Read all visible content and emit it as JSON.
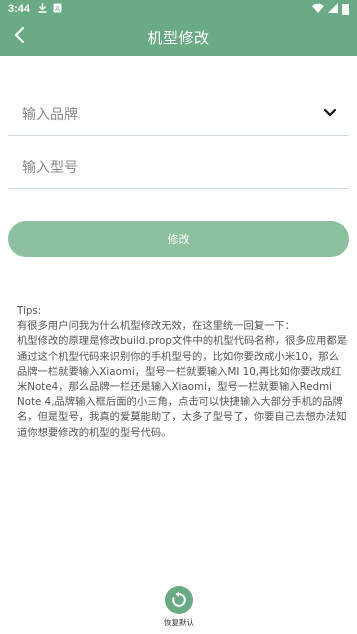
{
  "status_bar": {
    "time": "3:44",
    "icons": [
      "download-icon",
      "notification-a-icon"
    ],
    "right_icons": [
      "wifi-icon",
      "signal-icon",
      "battery-icon"
    ]
  },
  "app_bar": {
    "title": "机型修改",
    "back_icon": "chevron-left-icon"
  },
  "form": {
    "brand_placeholder": "输入品牌",
    "model_placeholder": "输入型号",
    "modify_label": "修改"
  },
  "tips": {
    "heading": "Tips:",
    "lines": [
      "有很多用户问我为什么机型修改无效，在这里统一回复一下：",
      "机型修改的原理是修改build.prop文件中的机型代码名称，很多应用都是通过这个机型代码来识别你的手机型号的，比如你要改成小米10，那么品牌一栏就要输入Xiaomi，型号一栏就要输入MI 10,再比如你要改成红米Note4，那么品牌一栏还是输入Xiaomi，型号一栏就要输入Redmi Note 4,品牌输入框后面的小三角，点击可以快捷输入大部分手机的品牌名，但是型号，我真的爱莫能助了，太多了型号了，你要自己去想办法知道你想要修改的机型的型号代码。"
    ]
  },
  "restore": {
    "label": "恢复默认",
    "icon": "restore-icon"
  },
  "colors": {
    "primary": "#6aaa84",
    "button": "#8cc09f",
    "divider": "#cfe3d6"
  }
}
